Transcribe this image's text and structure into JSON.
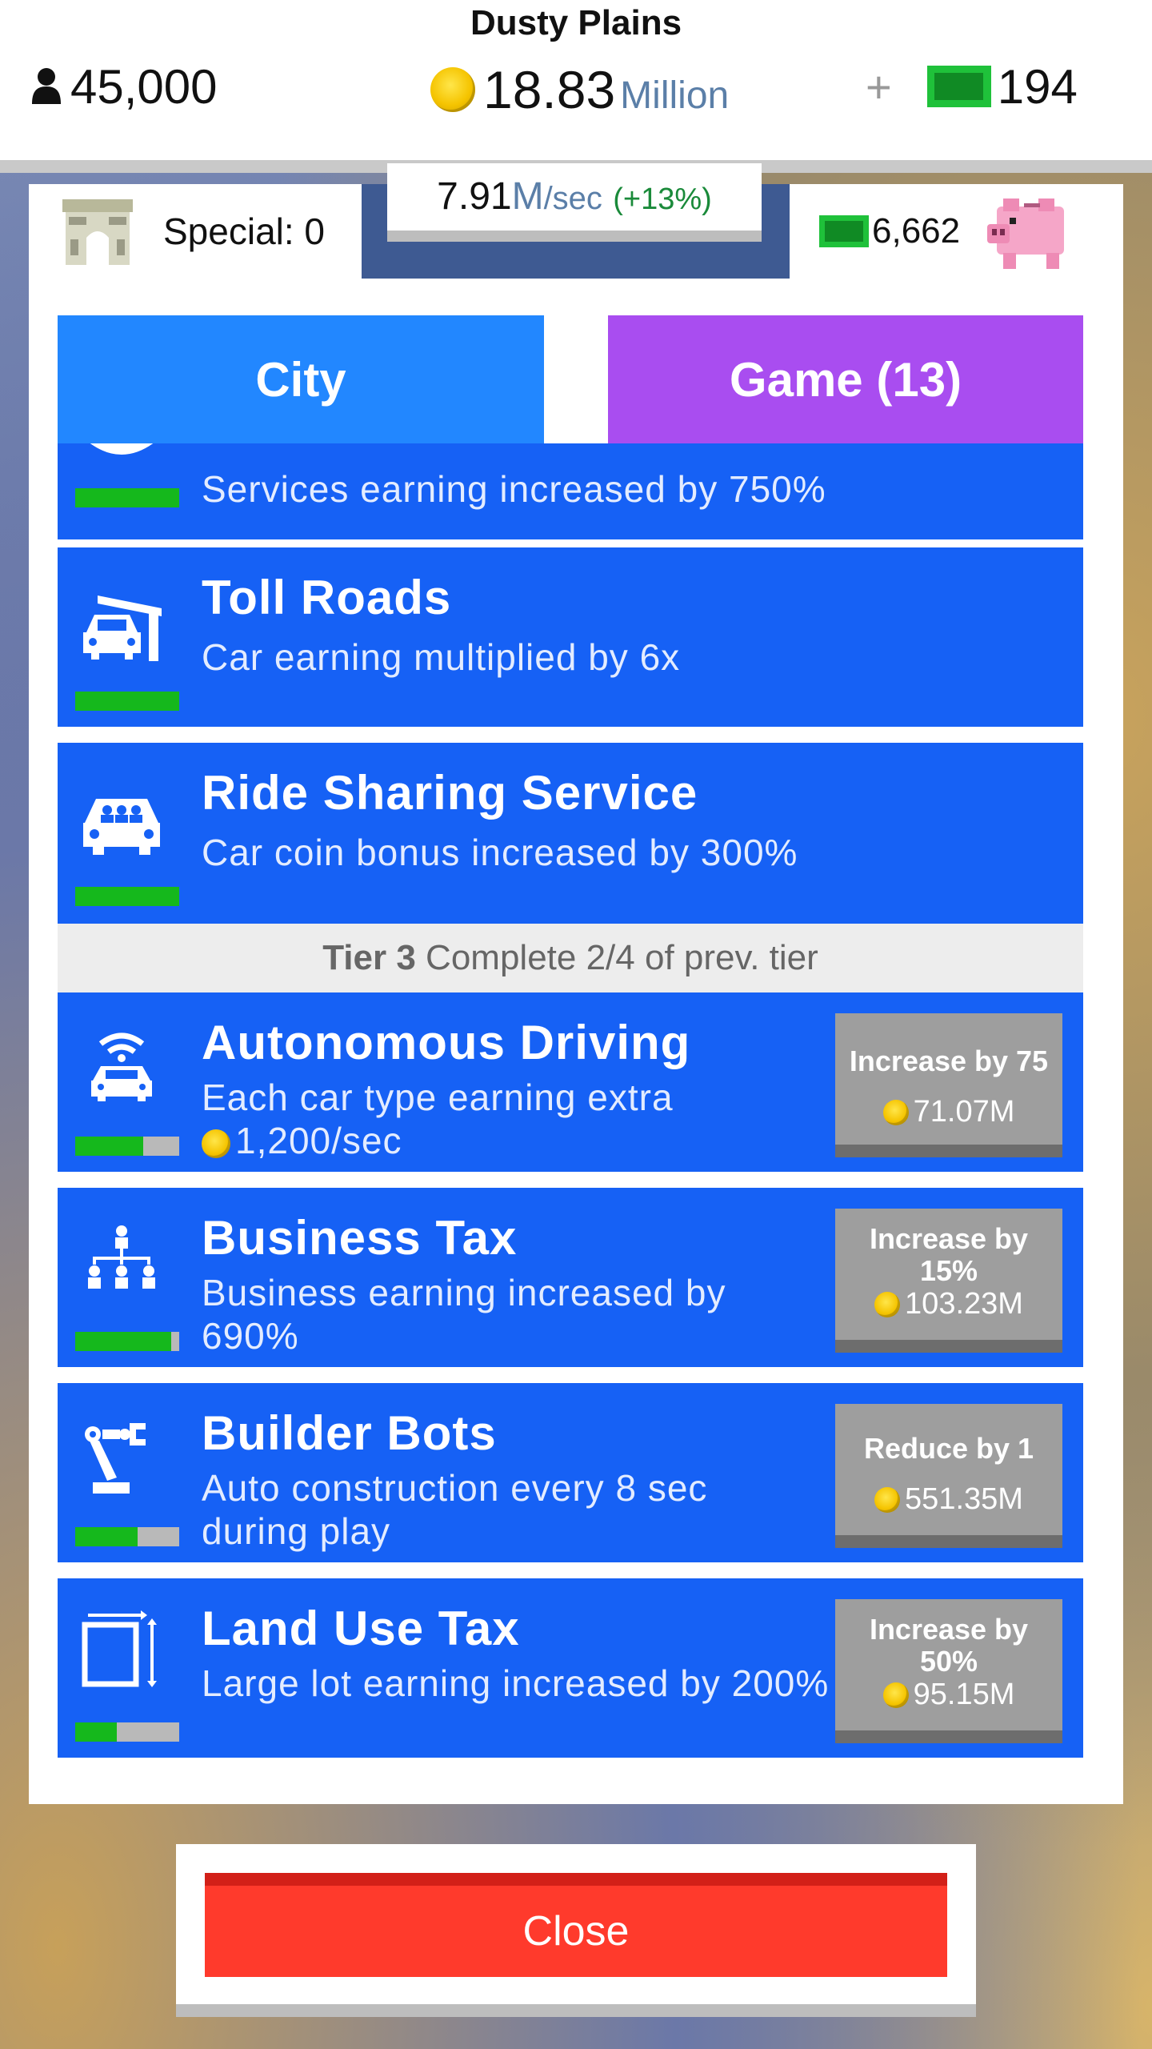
{
  "header": {
    "map_name": "Dusty Plains",
    "population": "45,000",
    "coins_amount": "18.83",
    "coins_unit": "Million",
    "plus": "+",
    "cash": "194"
  },
  "income": {
    "rate": "7.91",
    "unit": "M",
    "per": "/sec",
    "bonus": "(+13%)"
  },
  "special": {
    "label": "Special: 0"
  },
  "bank": {
    "amount": "6,662"
  },
  "tabs": {
    "city": "City",
    "game": "Game (13)"
  },
  "upgrades": [
    {
      "title": "",
      "description": "Services earning increased by 750%",
      "progress": 1.0
    },
    {
      "title": "Toll Roads",
      "description": "Car earning multiplied by 6x",
      "progress": 1.0
    },
    {
      "title": "Ride Sharing Service",
      "description": "Car coin bonus increased by 300%",
      "progress": 1.0
    }
  ],
  "tier3": {
    "name": "Tier 3",
    "requirement": "Complete 2/4 of prev. tier"
  },
  "tier3_upgrades": [
    {
      "title": "Autonomous Driving",
      "description": "Each car type earning extra",
      "description_amount": "1,200/sec",
      "button_label": "Increase by 75",
      "button_cost": "71.07M",
      "progress": 0.65
    },
    {
      "title": "Business Tax",
      "description": "Business earning increased by 690%",
      "button_label": "Increase by 15%",
      "button_cost": "103.23M",
      "progress": 0.92
    },
    {
      "title": "Builder Bots",
      "description": "Auto construction every 8 sec during play",
      "button_label": "Reduce by 1",
      "button_cost": "551.35M",
      "progress": 0.6
    },
    {
      "title": "Land Use Tax",
      "description": "Large lot earning increased by 200%",
      "button_label": "Increase by 50%",
      "button_cost": "95.15M",
      "progress": 0.4
    }
  ],
  "close": {
    "label": "Close"
  },
  "colors": {
    "row_blue": "#1661f5",
    "tab_city": "#2287ff",
    "tab_game": "#a94df0",
    "close_red": "#ff3a2c",
    "progress_green": "#15b81c"
  }
}
